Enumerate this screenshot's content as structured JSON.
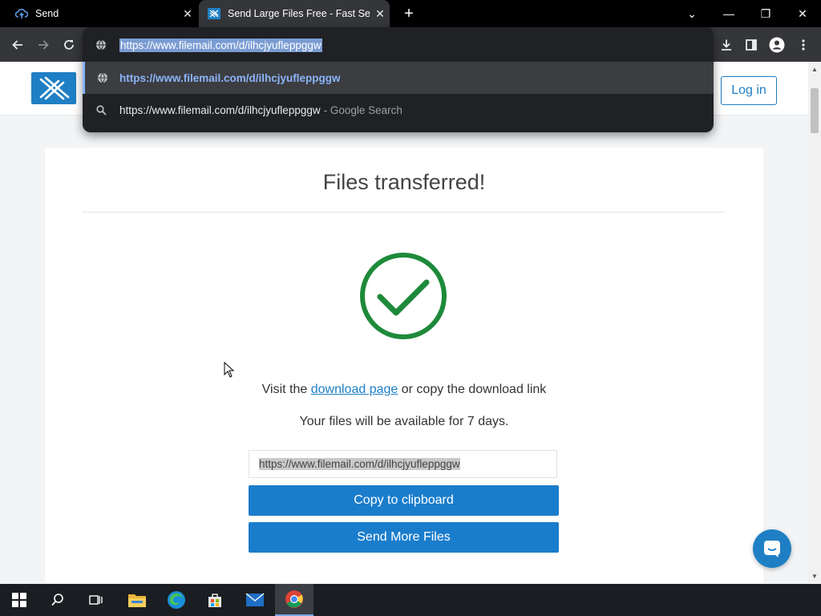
{
  "browser": {
    "tabs": [
      {
        "title": "Send",
        "close": "✕"
      },
      {
        "title": "Send Large Files Free - Fast Secure",
        "close": "✕"
      }
    ],
    "new_tab": "+",
    "window_controls": {
      "list": "⌄",
      "minimize": "—",
      "restore": "❐",
      "close": "✕"
    },
    "address": "https://www.filemail.com/d/ilhcjyufleppggw",
    "suggestions": [
      {
        "text": "https://www.filemail.com/d/ilhcjyufleppggw",
        "sub": ""
      },
      {
        "text": "https://www.filemail.com/d/ilhcjyufleppggw",
        "sub": "- Google Search"
      }
    ]
  },
  "header": {
    "login_label": "Log in"
  },
  "main": {
    "title": "Files transferred!",
    "visit_prefix": "Visit the",
    "download_page_link": "download page",
    "visit_suffix": "or copy the download link",
    "availability": "Your files will be available for 7 days.",
    "download_link": "https://www.filemail.com/d/ilhcjyufleppggw",
    "copy_button": "Copy to clipboard",
    "send_more_button": "Send More Files"
  },
  "colors": {
    "brand_blue": "#1f7fc4",
    "success_green": "#1e8a3a",
    "button_blue": "#1a7dcc"
  }
}
